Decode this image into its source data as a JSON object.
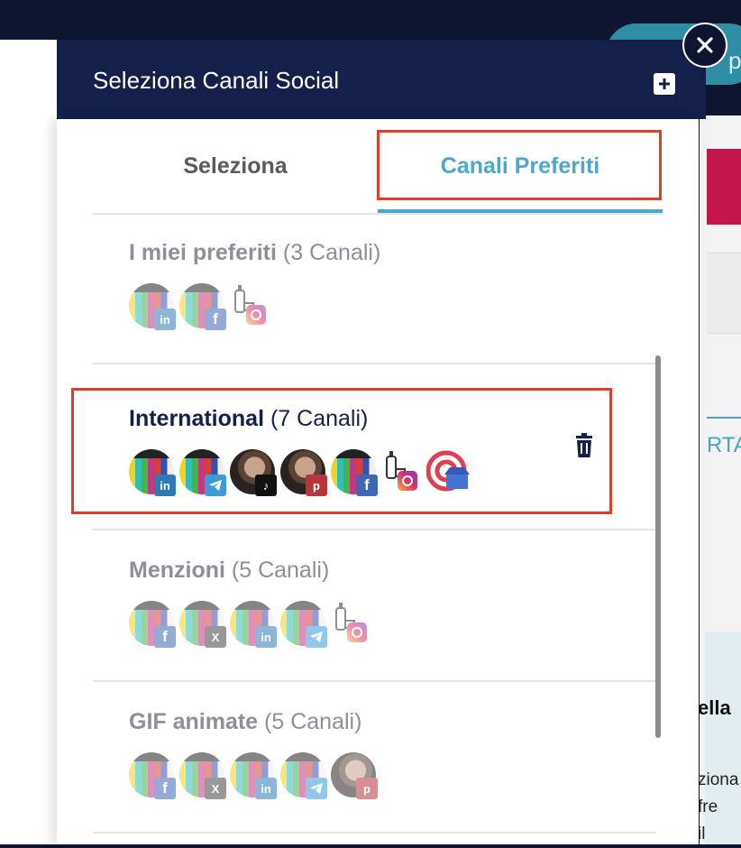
{
  "header": {
    "title": "Seleziona Canali Social",
    "add_icon": "plus-square-icon",
    "close_icon": "close-icon"
  },
  "tabs": [
    {
      "label": "Seleziona",
      "active": false
    },
    {
      "label": "Canali Preferiti",
      "active": true
    }
  ],
  "groups": [
    {
      "name": "I miei preferiti",
      "count": "(3 Canali)",
      "channels": [
        "linkedin",
        "facebook",
        "instagram-brand"
      ]
    },
    {
      "name": "International",
      "count": "(7 Canali)",
      "channels": [
        "linkedin",
        "telegram",
        "tiktok",
        "pinterest",
        "facebook",
        "instagram-brand",
        "google-my-business"
      ],
      "active": true,
      "delete_icon": "trash-icon"
    },
    {
      "name": "Menzioni",
      "count": "(5 Canali)",
      "channels": [
        "facebook",
        "x",
        "linkedin",
        "telegram",
        "instagram-brand"
      ]
    },
    {
      "name": "GIF animate",
      "count": "(5 Canali)",
      "channels": [
        "facebook",
        "x",
        "linkedin",
        "telegram",
        "pinterest"
      ]
    }
  ],
  "background": {
    "pill_text": "p",
    "tab_text": "RTA",
    "side_bold": "ella",
    "side_lines": [
      "ziona",
      "fre",
      "il"
    ]
  },
  "colors": {
    "navy": "#15204a",
    "accent": "#4aa8c8",
    "highlight": "#e03e2d"
  }
}
